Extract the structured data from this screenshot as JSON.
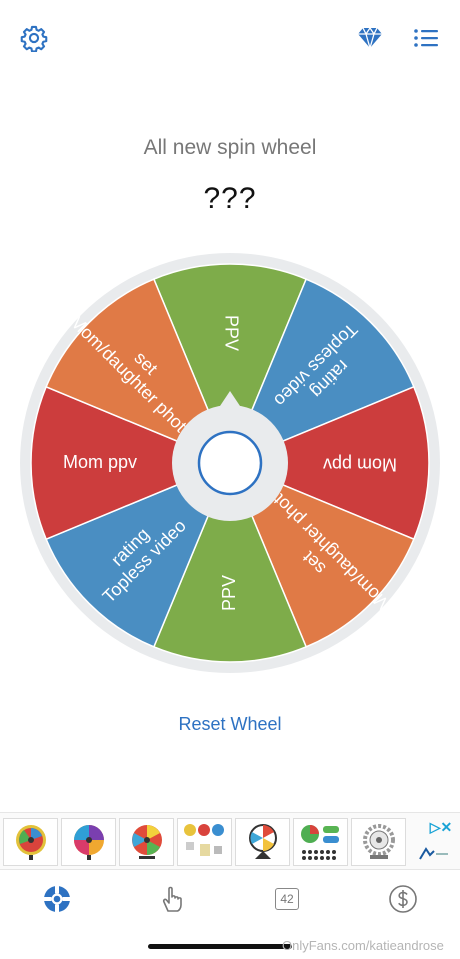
{
  "header": {
    "settings_icon": "gear-icon",
    "premium_icon": "diamond-icon",
    "list_icon": "list-icon"
  },
  "wheel": {
    "title": "All new spin wheel",
    "result": "???",
    "segments": [
      {
        "label": "PPV",
        "color": "#7eac4a"
      },
      {
        "label": "Topless video rating",
        "color": "#4a8ec2"
      },
      {
        "label": "Mom ppv",
        "color": "#cc3d3d"
      },
      {
        "label": "Mom/daughter photo set",
        "color": "#e07a46"
      },
      {
        "label": "PPV",
        "color": "#7eac4a"
      },
      {
        "label": "Topless video rating",
        "color": "#4a8ec2"
      },
      {
        "label": "Mom ppv",
        "color": "#cc3d3d"
      },
      {
        "label": "Mom/daughter photo set",
        "color": "#e07a46"
      }
    ],
    "reset_label": "Reset Wheel"
  },
  "ad": {
    "choices_label": "▷✕"
  },
  "tabs": [
    {
      "name": "wheel",
      "icon": "lifebuoy-icon",
      "active": true
    },
    {
      "name": "tap",
      "icon": "pointing-hand-icon"
    },
    {
      "name": "number",
      "label": "42"
    },
    {
      "name": "money",
      "icon": "dollar-icon"
    }
  ],
  "watermark": "OnlyFans.com/katieandrose",
  "colors": {
    "accent": "#2e72c2",
    "wheel_rim": "#e9ebed"
  }
}
